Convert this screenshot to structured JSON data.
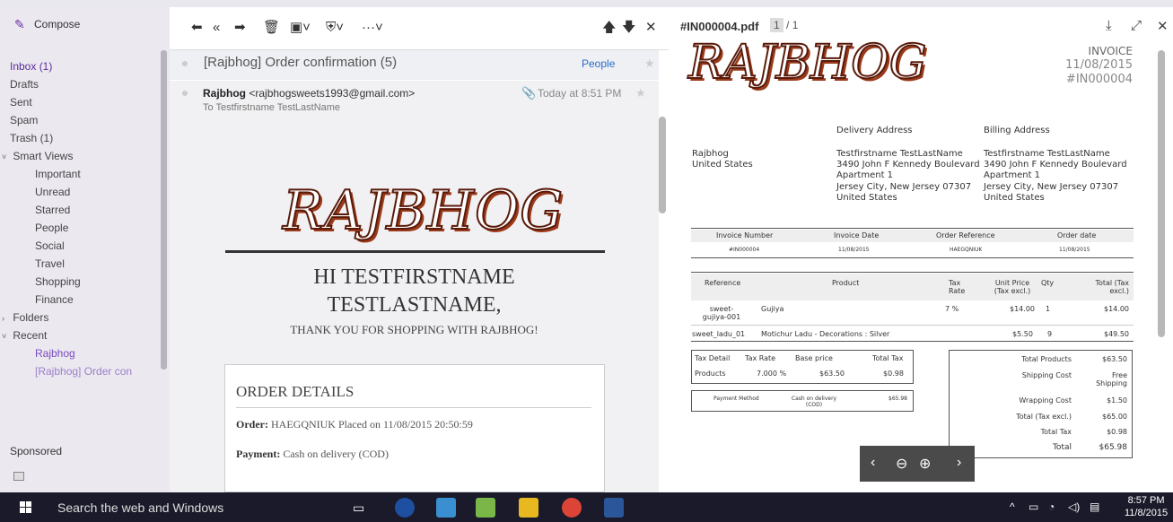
{
  "sidebar": {
    "compose": "Compose",
    "items": [
      {
        "label": "Inbox (1)"
      },
      {
        "label": "Drafts"
      },
      {
        "label": "Sent"
      },
      {
        "label": "Spam"
      },
      {
        "label": "Trash (1)"
      }
    ],
    "smart_views": {
      "label": "Smart Views",
      "items": [
        "Important",
        "Unread",
        "Starred",
        "People",
        "Social",
        "Travel",
        "Shopping",
        "Finance"
      ]
    },
    "folders": "Folders",
    "recent": {
      "label": "Recent",
      "items": [
        "Rajbhog",
        "[Rajbhog] Order con"
      ]
    },
    "sponsored": "Sponsored"
  },
  "thread": {
    "title": "[Rajbhog] Order confirmation (5)",
    "people_link": "People"
  },
  "message": {
    "sender_name": "Rajbhog",
    "sender_email": "<rajbhogsweets1993@gmail.com>",
    "to": "To  Testfirstname TestLastName",
    "time": "Today at 8:51 PM",
    "logo_text": "RAJBHOG",
    "hi_line1": "HI TESTFIRSTNAME",
    "hi_line2": "TESTLASTNAME,",
    "thanks": "THANK YOU FOR SHOPPING WITH RAJBHOG!",
    "order_title": "ORDER DETAILS",
    "order_label": "Order:",
    "order_value": "HAEGQNIUK Placed on 11/08/2015 20:50:59",
    "payment_label": "Payment:",
    "payment_value": "Cash on delivery (COD)"
  },
  "pdf": {
    "filename": "#IN000004.pdf",
    "page_current": "1",
    "page_total": "/ 1",
    "logo_text": "RAJBHOG",
    "invoice_label": "INVOICE",
    "invoice_date": "11/08/2015",
    "invoice_number": "#IN000004",
    "delivery_header": "Delivery Address",
    "billing_header": "Billing Address",
    "shop_name": "Rajbhog",
    "shop_country": "United States",
    "delivery": [
      "Testfirstname TestLastName",
      "3490 John F Kennedy Boulevard",
      "Apartment 1",
      "Jersey City, New Jersey 07307",
      "United States"
    ],
    "billing": [
      "Testfirstname TestLastName",
      "3490 John F Kennedy Boulevard",
      "Apartment 1",
      "Jersey City, New Jersey 07307",
      "United States"
    ],
    "info_headers": [
      "Invoice Number",
      "Invoice Date",
      "Order Reference",
      "Order date"
    ],
    "info_values": [
      "#IN000004",
      "11/08/2015",
      "HAEGQNIUK",
      "11/08/2015"
    ],
    "product_headers": {
      "reference": "Reference",
      "product": "Product",
      "tax_rate": "Tax Rate",
      "unit_price": "Unit Price (Tax excl.)",
      "qty": "Qty",
      "total": "Total (Tax excl.)"
    },
    "products": [
      {
        "reference": "sweet-gujiya-001",
        "product": "Gujiya",
        "tax": "7 %",
        "price": "$14.00",
        "qty": "1",
        "total": "$14.00"
      },
      {
        "reference": "sweet_ladu_01",
        "product": "Motichur Ladu - Decorations : Silver",
        "tax": "",
        "price": "$5.50",
        "qty": "9",
        "total": "$49.50"
      }
    ],
    "tax_headers": [
      "Tax Detail",
      "Tax Rate",
      "Base price",
      "Total Tax"
    ],
    "tax_row": [
      "Products",
      "7.000 %",
      "$63.50",
      "$0.98"
    ],
    "payment_method_label": "Payment Method",
    "payment_method_value": "Cash on delivery (COD)",
    "payment_amount": "$65.98",
    "totals": [
      {
        "label": "Total Products",
        "value": "$63.50"
      },
      {
        "label": "Shipping Cost",
        "value": "Free Shipping"
      },
      {
        "label": "Wrapping Cost",
        "value": "$1.50"
      },
      {
        "label": "Total (Tax excl.)",
        "value": "$65.00"
      },
      {
        "label": "Total Tax",
        "value": "$0.98"
      },
      {
        "label": "Total",
        "value": "$65.98"
      }
    ]
  },
  "taskbar": {
    "search": "Search the web and Windows",
    "time": "8:57 PM",
    "date": "11/8/2015"
  },
  "colors": {
    "sidebar_bg": "#ebe8f0",
    "accent_purple": "#5b2d9a",
    "link_blue": "#2a6ac8",
    "taskbar_bg": "#1a1a2a"
  }
}
